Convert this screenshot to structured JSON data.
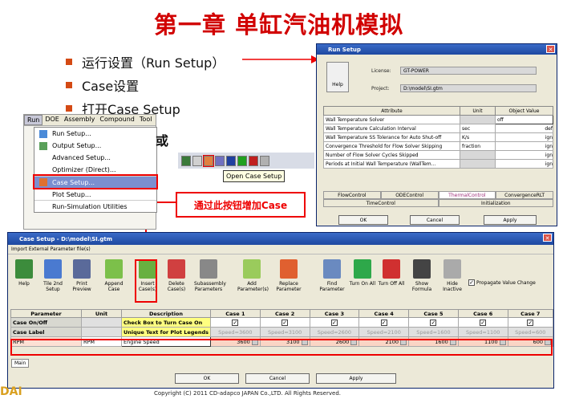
{
  "slide": {
    "title": "第一章 单缸汽油机模拟",
    "bullets": [
      "运行设置（Run Setup）",
      "Case设置",
      "打开Case Setup"
    ],
    "or_text": "或",
    "callout": "通过此按钮增加Case",
    "tooltip": "Open Case Setup",
    "copyright": "Copyright (C) 2011 CD-adapco JAPAN Co.,LTD. All Rights Reserved.",
    "logo_fragment": "DAI"
  },
  "menu": {
    "bar": [
      "Run",
      "DOE",
      "Assembly",
      "Compound",
      "Tool"
    ],
    "items": [
      "Run Setup...",
      "Output Setup...",
      "Advanced Setup...",
      "Optimizer (Direct)...",
      "Case Setup...",
      "Plot Setup...",
      "Run-Simulation Utilities"
    ]
  },
  "run_setup": {
    "title": "Run Setup",
    "help": "Help",
    "license_label": "License:",
    "license_value": "GT-POWER",
    "project_label": "Project:",
    "project_value": "D:\\model\\SI.gtm",
    "headers": [
      "Attribute",
      "Unit",
      "Object Value"
    ],
    "rows": [
      {
        "attr": "Wall Temperature Solver",
        "unit": "",
        "value": "off"
      },
      {
        "attr": "Wall Temperature Calculation Interval",
        "unit": "sec",
        "value": "def"
      },
      {
        "attr": "Wall Temperature SS Tolerance for Auto Shut-off",
        "unit": "K/s",
        "value": "ign"
      },
      {
        "attr": "Convergence Threshold for Flow Solver Skipping",
        "unit": "fraction",
        "value": "ign"
      },
      {
        "attr": "Number of Flow Solver Cycles Skipped",
        "unit": "",
        "value": "ign"
      },
      {
        "attr": "Periods at Initial Wall Temperature (WallTem...",
        "unit": "",
        "value": "ign"
      }
    ],
    "tabs_row1": [
      "FlowControl",
      "ODEControl",
      "ThermalControl",
      "ConvergenceRLT"
    ],
    "tabs_row2": [
      "TimeControl",
      "Initialization"
    ],
    "ok": "OK",
    "cancel": "Cancel",
    "apply": "Apply"
  },
  "case_setup": {
    "title": "Case Setup - D:\\model\\SI.gtm",
    "import_line": "Import External Parameter file(s)",
    "tools": [
      {
        "label": "Help",
        "color": "#3c8c3c"
      },
      {
        "label": "Tile 2nd Setup",
        "color": "#4a7ad0"
      },
      {
        "label": "Print Preview",
        "color": "#5a6a9a"
      },
      {
        "label": "Append Case",
        "color": "#7cc04a"
      },
      {
        "label": "Insert Case(s)",
        "color": "#68b040"
      },
      {
        "label": "Delete Case(s)",
        "color": "#d04040"
      },
      {
        "label": "Subassembly Parameters",
        "color": "#888888"
      },
      {
        "label": "Add Parameter(s)",
        "color": "#9acb5c"
      },
      {
        "label": "Replace Parameter",
        "color": "#e06030"
      },
      {
        "label": "Find Parameter",
        "color": "#6a8ac0"
      },
      {
        "label": "Turn On All",
        "color": "#2ea84a"
      },
      {
        "label": "Turn Off All",
        "color": "#d03030"
      },
      {
        "label": "Show Formula",
        "color": "#444444"
      },
      {
        "label": "Hide Inactive",
        "color": "#aaaaaa"
      }
    ],
    "propagate": "Propagate Value Change",
    "headers": [
      "Parameter",
      "Unit",
      "Description",
      "Case 1",
      "Case 2",
      "Case 3",
      "Case 4",
      "Case 5",
      "Case 6",
      "Case 7"
    ],
    "row_onoff": {
      "param": "Case On/Off",
      "desc": "Check Box to Turn Case On"
    },
    "row_label": {
      "param": "Case Label",
      "desc": "Unique Text for Plot Legends",
      "values": [
        "Speed=3600",
        "Speed=3100",
        "Speed=2600",
        "Speed=2100",
        "Speed=1600",
        "Speed=1100",
        "Speed=600"
      ]
    },
    "row_rpm": {
      "param": "RPM",
      "unit": "RPM",
      "desc": "Engine Speed",
      "values": [
        "3600",
        "3100",
        "2600",
        "2100",
        "1600",
        "1100",
        "600"
      ]
    },
    "sheet_tab": "Main",
    "ok": "OK",
    "cancel": "Cancel",
    "apply": "Apply"
  }
}
